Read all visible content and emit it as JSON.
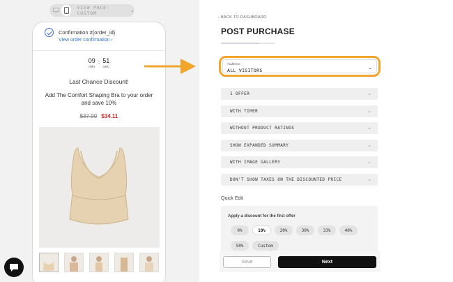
{
  "preview": {
    "view_page_label": "VIEW PAGE: CUSTOM",
    "confirmation_title": "Confirmation #{order_id}",
    "confirmation_link": "View order confirmation ›",
    "timer": {
      "minutes": "09",
      "seconds": "51",
      "min_unit": "min",
      "sec_unit": "sec",
      "separator": ":"
    },
    "last_chance": "Last Chance Discount!",
    "offer_text": "Add The Comfort Shaping Bra to your order and save 10%",
    "old_price": "$37.90",
    "new_price": "$34.11"
  },
  "editor": {
    "back_link": "‹ BACK TO DASHBOARD",
    "title": "POST PURCHASE",
    "progress": 0.7,
    "audience": {
      "label": "Audience",
      "value": "ALL VISITORS"
    },
    "accordions": [
      "1 OFFER",
      "WITH TIMER",
      "WITHOUT PRODUCT RATINGS",
      "SHOW EXPANDED SUMMARY",
      "WITH IMAGE GALLERY",
      "DON'T SHOW TAXES ON THE DISCOUNTED PRICE"
    ],
    "quick_edit": {
      "title": "Quick Edit",
      "heading": "Apply a discount for the first offer",
      "chips": [
        "0%",
        "10%",
        "20%",
        "30%",
        "33%",
        "40%",
        "50%",
        "Custom"
      ],
      "selected": "10%"
    },
    "save_label": "Save",
    "next_label": "Next"
  },
  "colors": {
    "highlight": "#f2a52c",
    "link": "#2f6fd4",
    "sale": "#d32f2f",
    "primary_button": "#111111"
  }
}
